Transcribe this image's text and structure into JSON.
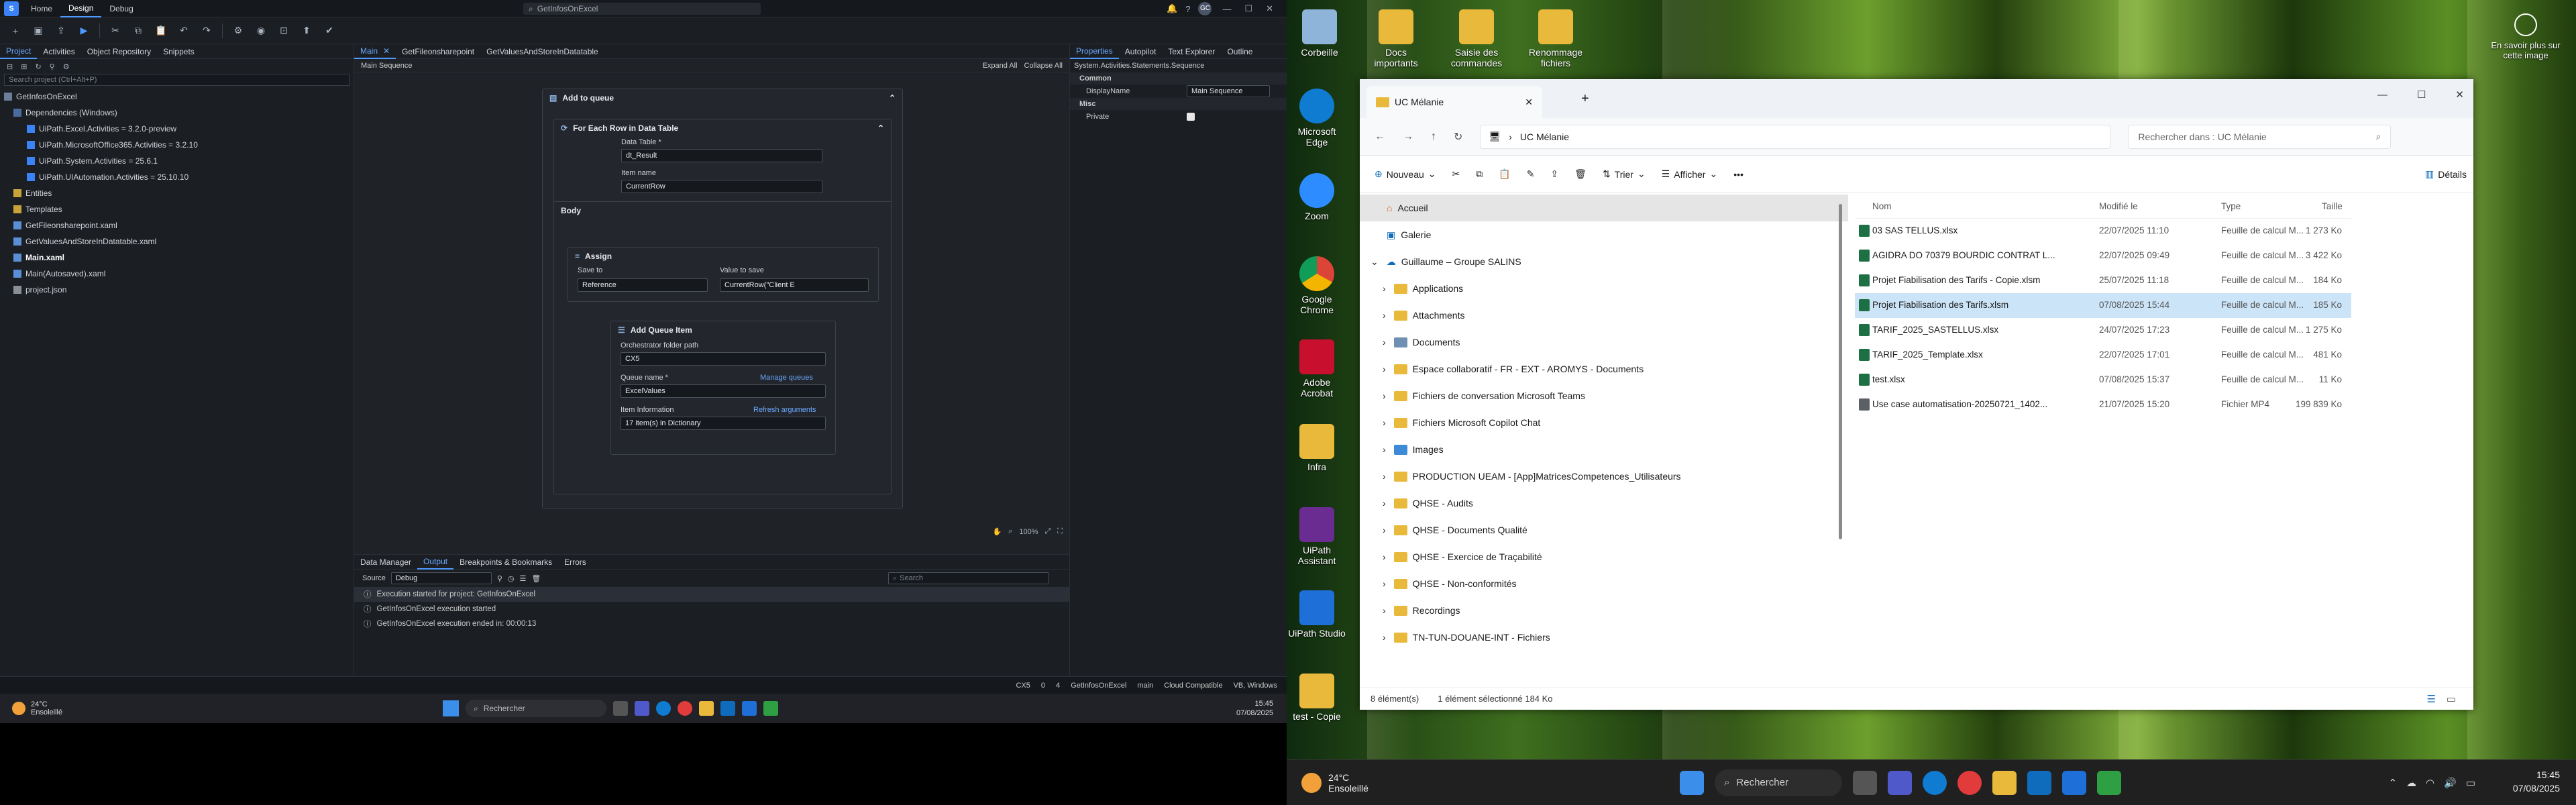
{
  "studio": {
    "menu": [
      "Home",
      "Design",
      "Debug"
    ],
    "search_placeholder": "GetInfosOnExcel",
    "panel_tabs": [
      "Project",
      "Activities",
      "Object Repository",
      "Snippets"
    ],
    "project_search_placeholder": "Search project (Ctrl+Alt+P)",
    "tree": {
      "root": "GetInfosOnExcel",
      "dependencies": "Dependencies (Windows)",
      "deps": [
        "UiPath.Excel.Activities = 3.2.0-preview",
        "UiPath.MicrosoftOffice365.Activities = 3.2.10",
        "UiPath.System.Activities = 25.6.1",
        "UiPath.UIAutomation.Activities = 25.10.10"
      ],
      "folders": [
        "Entities",
        "Templates"
      ],
      "files": [
        "GetFileonsharepoint.xaml",
        "GetValuesAndStoreInDatatable.xaml",
        "Main.xaml",
        "Main(Autosaved).xaml",
        "project.json"
      ]
    },
    "doc_tabs": [
      "Main",
      "GetFileonsharepoint",
      "GetValuesAndStoreInDatatable"
    ],
    "breadcrumb": "Main Sequence",
    "expand_all": "Expand All",
    "collapse_all": "Collapse All",
    "workflow": {
      "add_to_queue": "Add to queue",
      "foreach": "For Each Row in Data Table",
      "data_table_label": "Data Table *",
      "data_table_value": "dt_Result",
      "item_name_label": "Item name",
      "item_name_value": "CurrentRow",
      "body": "Body",
      "assign": "Assign",
      "save_to_label": "Save to",
      "value_to_save_label": "Value to save",
      "save_to_value": "Reference",
      "value_to_save_value": "CurrentRow(\"Client E",
      "add_queue_item": "Add Queue Item",
      "orch_folder_label": "Orchestrator folder path",
      "orch_folder_value": "CX5",
      "queue_name_label": "Queue name *",
      "manage_queues": "Manage queues",
      "queue_name_value": "ExcelValues",
      "item_info_label": "Item Information",
      "refresh_args": "Refresh arguments",
      "item_info_value": "17 item(s) in Dictionary"
    },
    "zoom": "100%",
    "props_tabs": [
      "Properties",
      "Autopilot",
      "Text Explorer",
      "Outline"
    ],
    "props_path": "System.Activities.Statements.Sequence",
    "props": {
      "common": "Common",
      "display_name_label": "DisplayName",
      "display_name_value": "Main Sequence",
      "misc": "Misc",
      "private_label": "Private"
    },
    "output_tabs": [
      "Data Manager",
      "Output",
      "Breakpoints & Bookmarks",
      "Errors"
    ],
    "output_source_label": "Source",
    "output_source_value": "Debug",
    "output_search_placeholder": "Search",
    "output_lines": [
      "Execution started for project: GetInfosOnExcel",
      "GetInfosOnExcel execution started",
      "GetInfosOnExcel execution ended in: 00:00:13"
    ],
    "status": {
      "orch": "CX5",
      "zero": "0",
      "four": "4",
      "project": "GetInfosOnExcel",
      "branch": "main",
      "compat": "Cloud Compatible",
      "lang": "VB, Windows"
    }
  },
  "taskbar1": {
    "weather_temp": "24°C",
    "weather_desc": "Ensoleillé",
    "search": "Rechercher",
    "time": "15:45",
    "date": "07/08/2025"
  },
  "desktop": {
    "icons_top": [
      "Corbeille",
      "Docs importants",
      "Saisie des commandes",
      "Renommage fichiers"
    ],
    "icons_left": [
      "Microsoft Edge",
      "Zoom",
      "Google Chrome",
      "Adobe Acrobat",
      "Infra",
      "UiPath Assistant",
      "UiPath Studio",
      "test - Copie"
    ],
    "learn_more": "En savoir plus sur cette image"
  },
  "explorer": {
    "tab_title": "UC Mélanie",
    "address": "UC Mélanie",
    "search_placeholder": "Rechercher dans : UC Mélanie",
    "cmd": {
      "new": "Nouveau",
      "sort": "Trier",
      "view": "Afficher",
      "details": "Détails"
    },
    "nav": {
      "home": "Accueil",
      "gallery": "Galerie",
      "onedrive": "Guillaume – Groupe SALINS",
      "folders": [
        "Applications",
        "Attachments",
        "Documents",
        "Espace collaboratif - FR - EXT - AROMYS - Documents",
        "Fichiers de conversation Microsoft Teams",
        "Fichiers Microsoft Copilot Chat",
        "Images",
        "PRODUCTION UEAM - [App]MatricesCompetences_Utilisateurs",
        "QHSE - Audits",
        "QHSE - Documents Qualité",
        "QHSE - Exercice de Traçabilité",
        "QHSE - Non-conformités",
        "Recordings",
        "TN-TUN-DOUANE-INT - Fichiers"
      ]
    },
    "columns": [
      "Nom",
      "Modifié le",
      "Type",
      "Taille"
    ],
    "files": [
      {
        "name": "03 SAS TELLUS.xlsx",
        "date": "22/07/2025 11:10",
        "type": "Feuille de calcul M...",
        "size": "1 273 Ko",
        "kind": "xl"
      },
      {
        "name": "AGIDRA DO 70379 BOURDIC CONTRAT L...",
        "date": "22/07/2025 09:49",
        "type": "Feuille de calcul M...",
        "size": "3 422 Ko",
        "kind": "xl"
      },
      {
        "name": "Projet Fiabilisation des Tarifs - Copie.xlsm",
        "date": "25/07/2025 11:18",
        "type": "Feuille de calcul M...",
        "size": "184 Ko",
        "kind": "xl"
      },
      {
        "name": "Projet Fiabilisation des Tarifs.xlsm",
        "date": "07/08/2025 15:44",
        "type": "Feuille de calcul M...",
        "size": "185 Ko",
        "kind": "xl",
        "selected": true
      },
      {
        "name": "TARIF_2025_SASTELLUS.xlsx",
        "date": "24/07/2025 17:23",
        "type": "Feuille de calcul M...",
        "size": "1 275 Ko",
        "kind": "xl"
      },
      {
        "name": "TARIF_2025_Template.xlsx",
        "date": "22/07/2025 17:01",
        "type": "Feuille de calcul M...",
        "size": "481 Ko",
        "kind": "xl"
      },
      {
        "name": "test.xlsx",
        "date": "07/08/2025 15:37",
        "type": "Feuille de calcul M...",
        "size": "11 Ko",
        "kind": "xl"
      },
      {
        "name": "Use case automatisation-20250721_1402...",
        "date": "21/07/2025 15:20",
        "type": "Fichier MP4",
        "size": "199 839 Ko",
        "kind": "mp4"
      }
    ],
    "status_count": "8 élément(s)",
    "status_sel": "1 élément sélectionné  184 Ko"
  },
  "taskbar2": {
    "weather_temp": "24°C",
    "weather_desc": "Ensoleillé",
    "search": "Rechercher",
    "time": "15:45",
    "date": "07/08/2025"
  }
}
